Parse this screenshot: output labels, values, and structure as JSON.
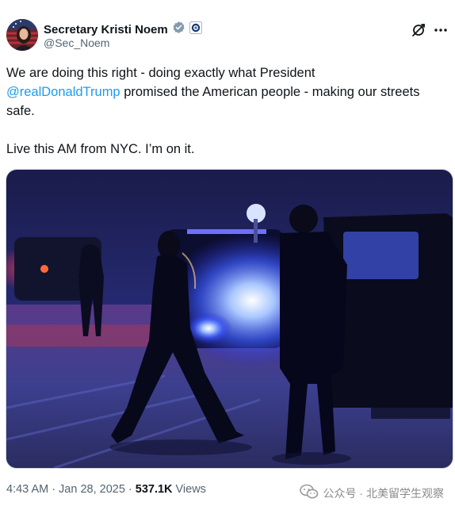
{
  "author": {
    "display_name": "Secretary Kristi Noem",
    "handle": "@Sec_Noem",
    "verified_color": "#829aab"
  },
  "tweet": {
    "line1": "We are doing this right - doing exactly what President",
    "mention": "@realDonaldTrump",
    "line2_rest": " promised the American people - making our streets safe.",
    "line3": "Live this AM from NYC. I’m on it."
  },
  "meta": {
    "time": "4:43 AM",
    "separator": "·",
    "date": "Jan 28, 2025",
    "views_count": "537.1K",
    "views_label": "Views"
  },
  "watermark": {
    "text": "公众号 · 北美留学生观察"
  },
  "icons": {
    "verified": "verified-badge-icon",
    "agency": "agency-seal-icon",
    "grok": "grok-icon",
    "more": "more-icon",
    "wechat": "wechat-icon"
  },
  "colors": {
    "link": "#1d9bf0",
    "text": "#0f1419",
    "secondary": "#536471"
  }
}
